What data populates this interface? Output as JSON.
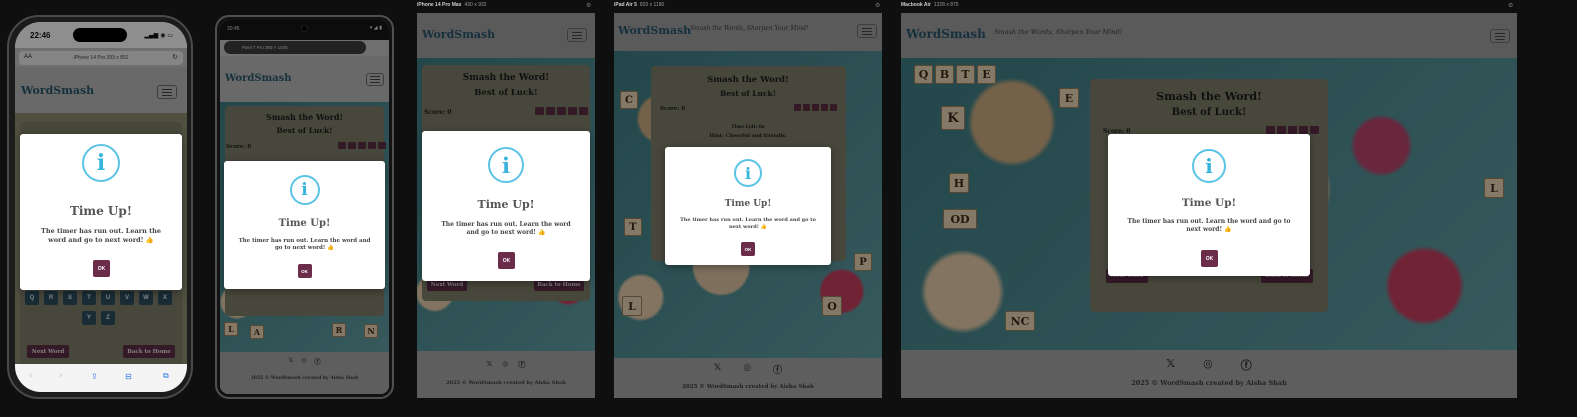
{
  "app": {
    "brand": "WordSmash",
    "tagline": "Smash the Words, Sharpen Your Mind!",
    "game_title_line1": "Smash the Word!",
    "game_title_line2": "Best of Luck!",
    "score": "Score: 0",
    "time_left": "Time Left: 0s",
    "hint": "Hint: Cheerful and friendly.",
    "next_word": "Next Word",
    "back_home": "Back to Home",
    "copyright": "2025 © WordSmash created by Aisha Shah",
    "social_icons": [
      "x-icon",
      "instagram-icon",
      "facebook-icon"
    ],
    "social_glyphs": {
      "x": "𝕏",
      "instagram": "◎",
      "facebook": "ⓕ"
    },
    "keys_row1": [
      "Q",
      "R",
      "S",
      "T",
      "U",
      "V",
      "W",
      "X"
    ],
    "keys_row2": [
      "Y",
      "Z"
    ]
  },
  "modal": {
    "icon_glyph": "i",
    "title": "Time Up!",
    "message": "The timer has run out. Learn the word and go to next word! 👍",
    "ok": "OK"
  },
  "devices": {
    "iphone14pro": {
      "clock": "22:46",
      "url_aa": "AA",
      "url_text": "iPhone 14 Pro  393 x 852"
    },
    "pixel7": {
      "clock": "20:45",
      "url_text": "Pixel 7 Pro  393 × 1040"
    },
    "iphone14promax": {
      "label": "iPhone 14 Pro Max",
      "size": "430 x 932"
    },
    "ipadair": {
      "label": "iPad Air 5",
      "size": "820 x 1180"
    },
    "macbookair": {
      "label": "Macbook Air",
      "size": "1328 x 875"
    }
  },
  "colors": {
    "brand": "#27536a",
    "maroon": "#5a2b44",
    "modal_icon": "#38b4dd",
    "game_box": "#7b7a66",
    "navbar": "#9c9c9c"
  }
}
